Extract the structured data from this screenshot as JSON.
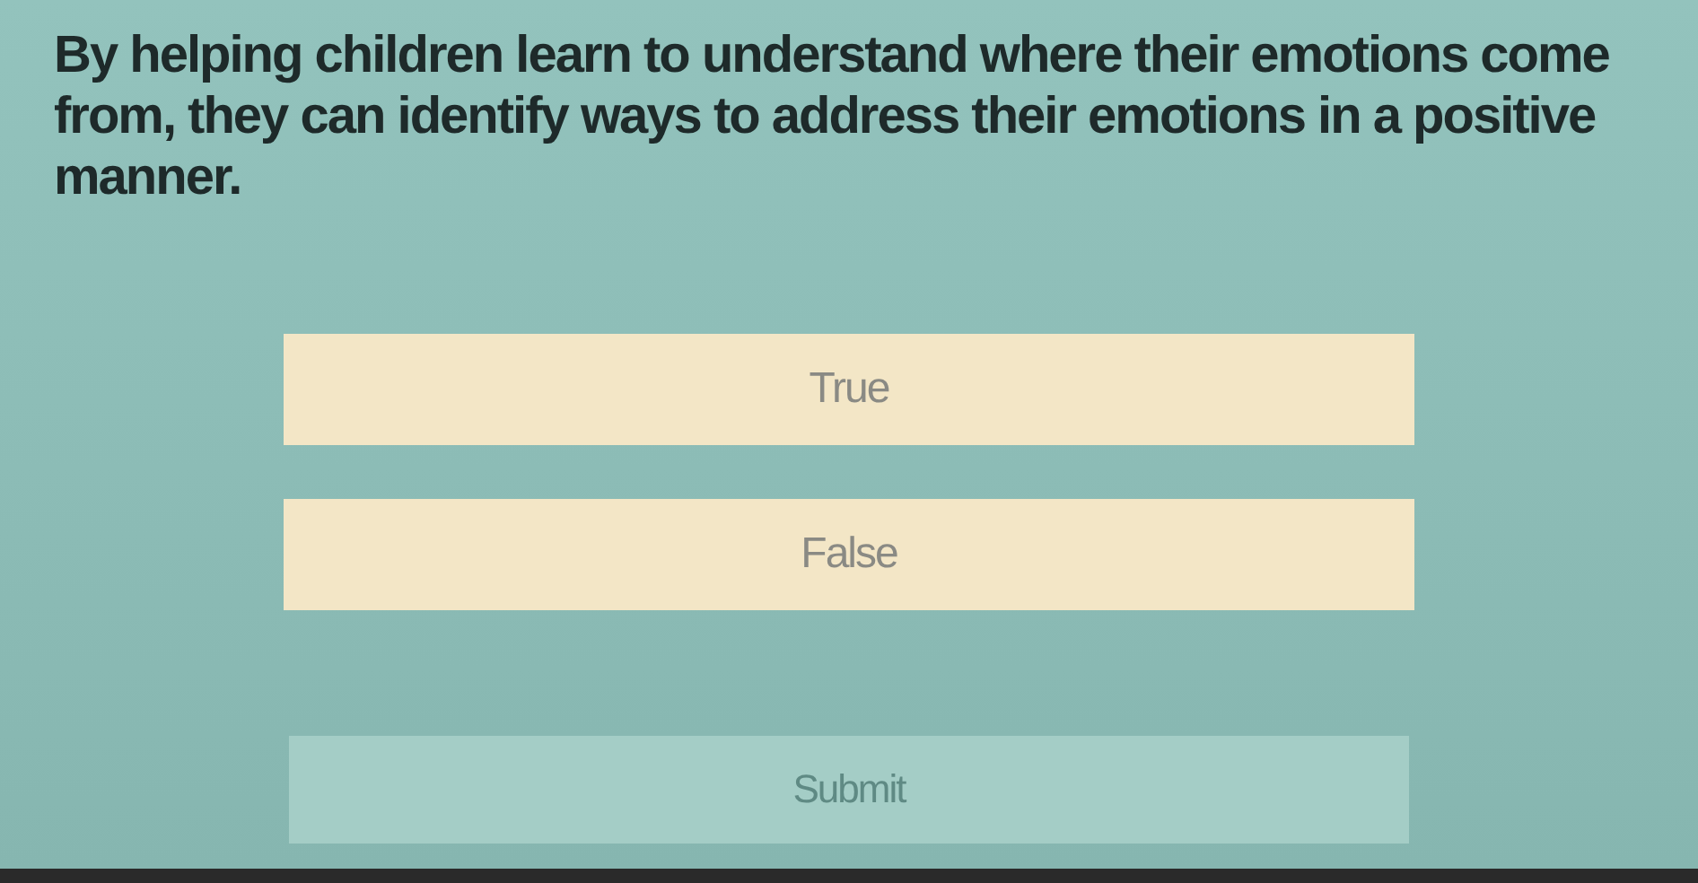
{
  "question": {
    "text": "By helping children learn to understand where their emotions come from, they can identify ways to address their emotions in a positive manner."
  },
  "options": [
    {
      "label": "True",
      "selected": false
    },
    {
      "label": "False",
      "selected": false
    }
  ],
  "submit": {
    "label": "Submit",
    "disabled": true
  }
}
